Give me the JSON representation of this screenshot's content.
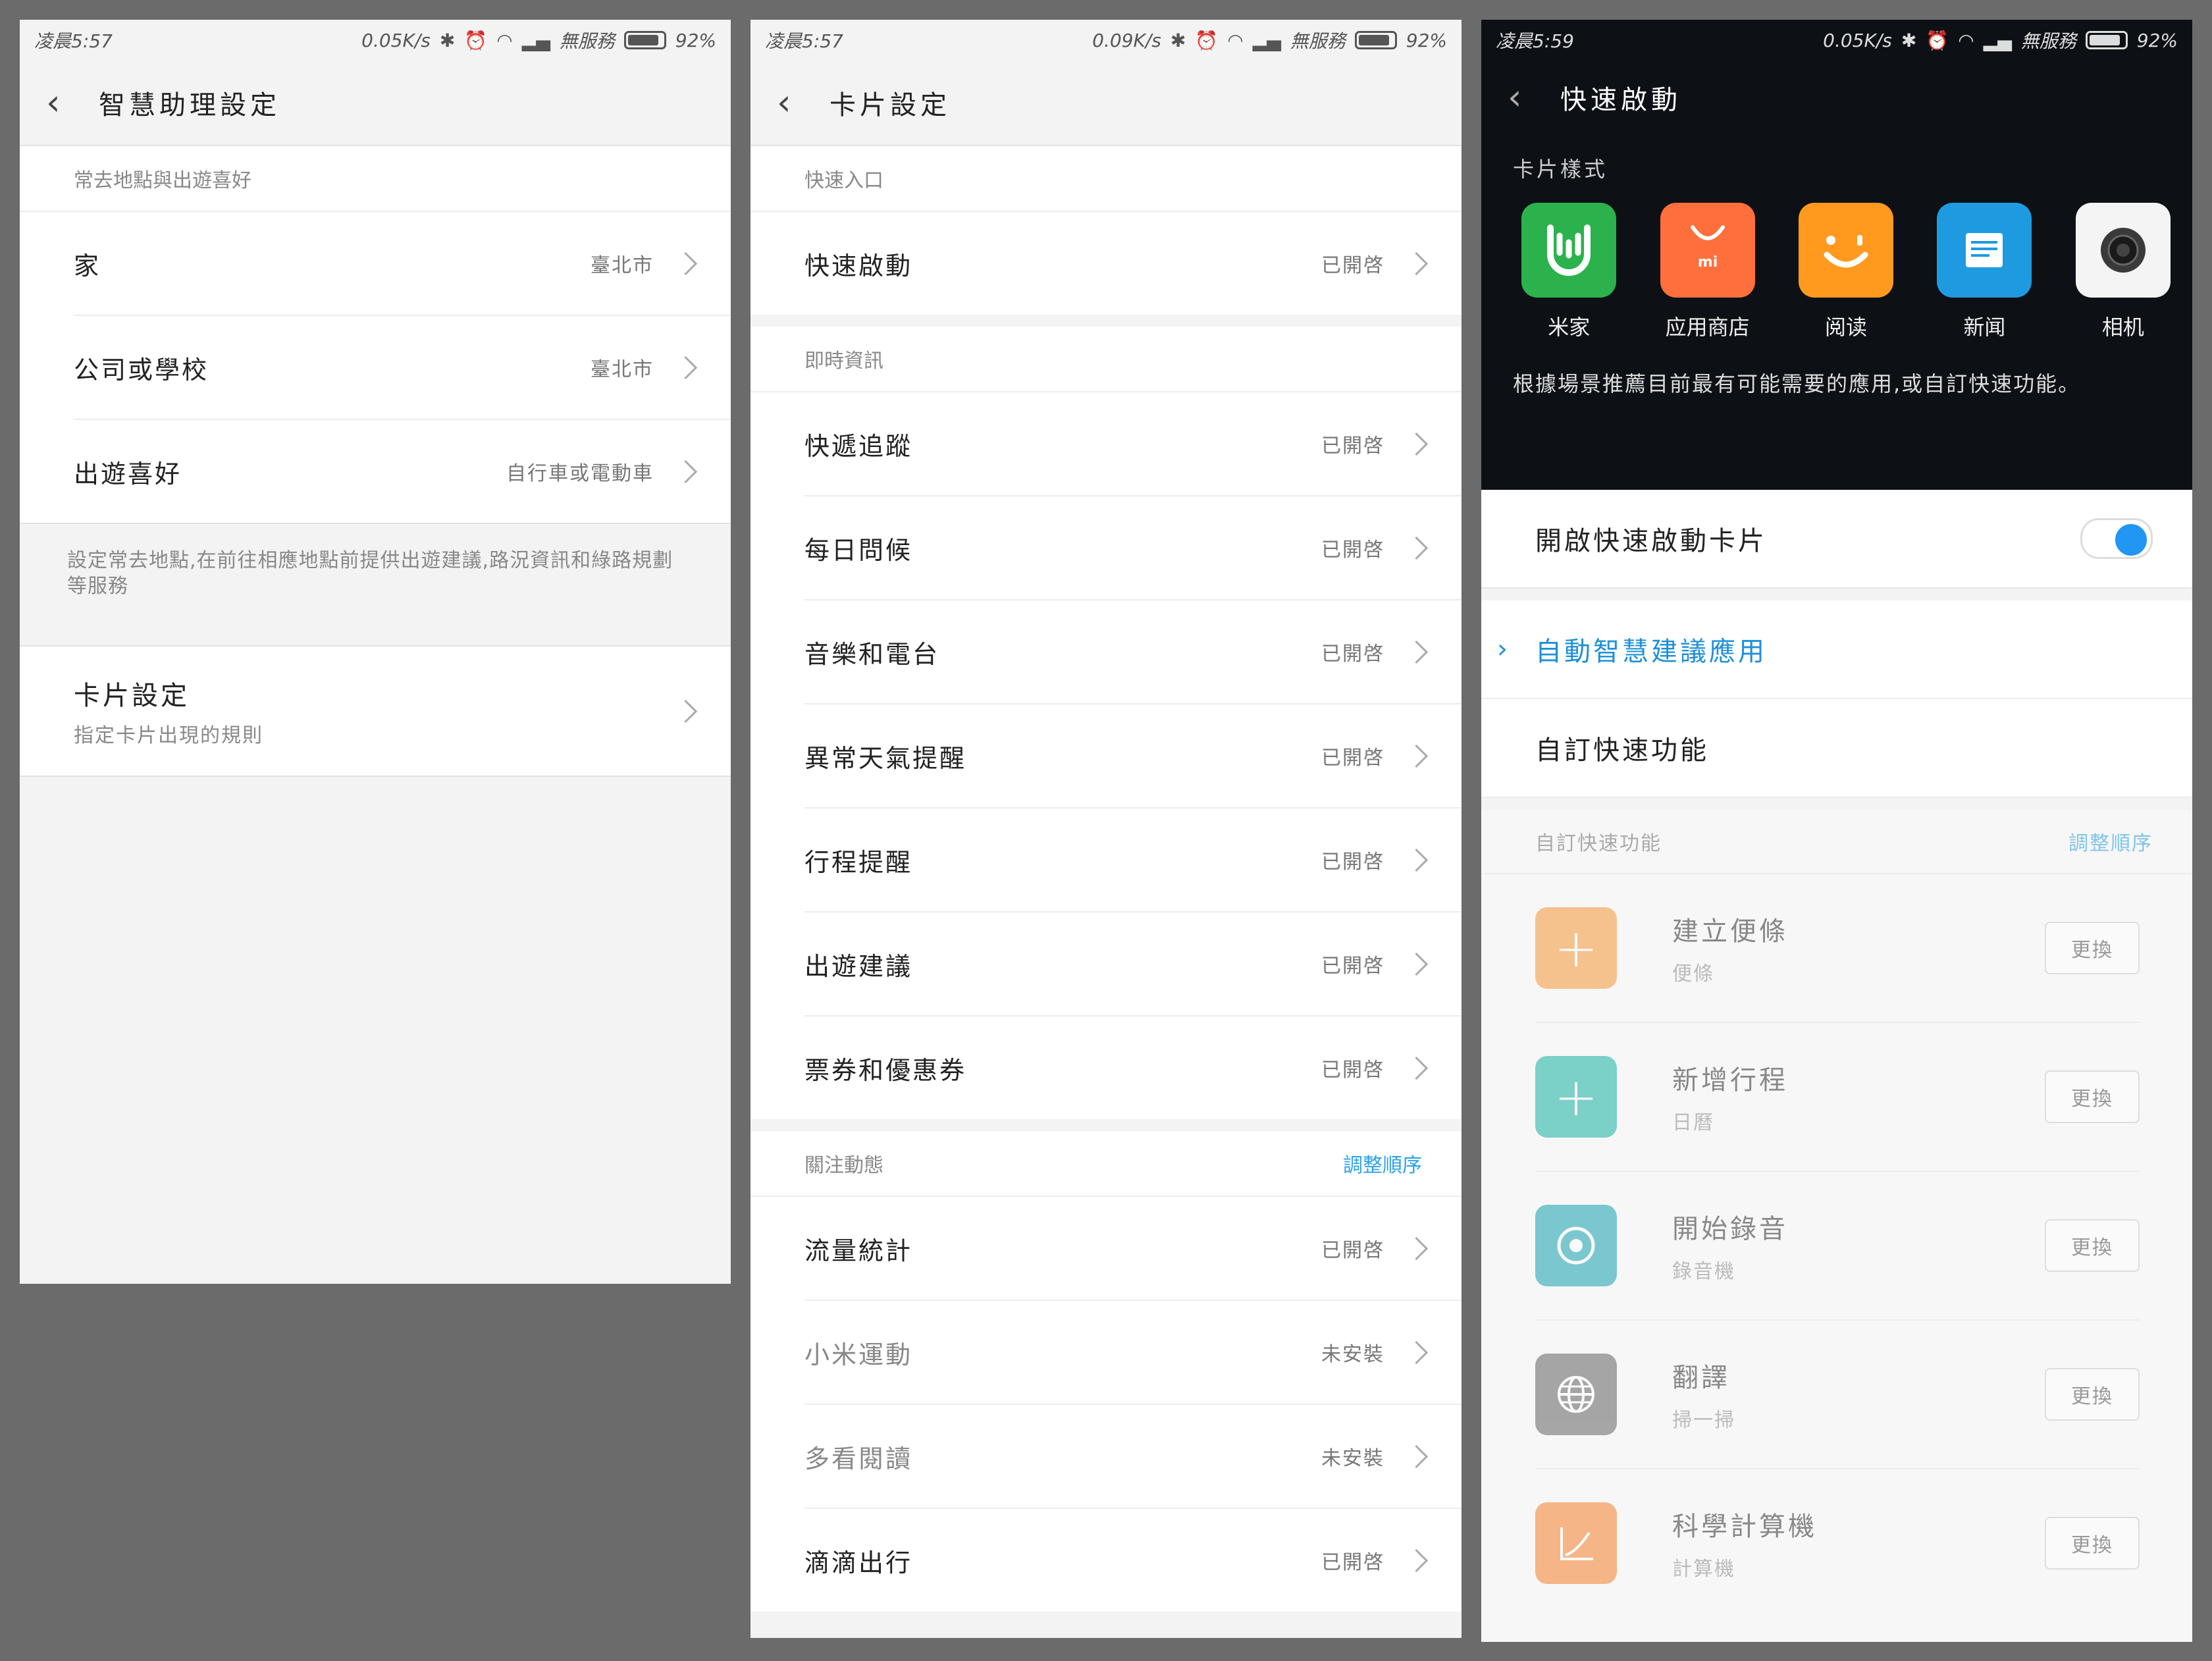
{
  "panel1": {
    "status": {
      "time": "凌晨5:57",
      "speed": "0.05K/s",
      "service": "無服務",
      "battery": "92%"
    },
    "title": "智慧助理設定",
    "section_header": "常去地點與出遊喜好",
    "rows": [
      {
        "label": "家",
        "value": "臺北市"
      },
      {
        "label": "公司或學校",
        "value": "臺北市"
      },
      {
        "label": "出遊喜好",
        "value": "自行車或電動車"
      }
    ],
    "note": "設定常去地點,在前往相應地點前提供出遊建議,路況資訊和綠路規劃等服務",
    "card_settings": {
      "title": "卡片設定",
      "subtitle": "指定卡片出現的規則"
    }
  },
  "panel2": {
    "status": {
      "time": "凌晨5:57",
      "speed": "0.09K/s",
      "service": "無服務",
      "battery": "92%"
    },
    "title": "卡片設定",
    "sections": [
      {
        "header": "快速入口",
        "rows": [
          {
            "label": "快速啟動",
            "value": "已開啓"
          }
        ]
      },
      {
        "header": "即時資訊",
        "rows": [
          {
            "label": "快遞追蹤",
            "value": "已開啓"
          },
          {
            "label": "每日問候",
            "value": "已開啓"
          },
          {
            "label": "音樂和電台",
            "value": "已開啓"
          },
          {
            "label": "異常天氣提醒",
            "value": "已開啓"
          },
          {
            "label": "行程提醒",
            "value": "已開啓"
          },
          {
            "label": "出遊建議",
            "value": "已開啓"
          },
          {
            "label": "票券和優惠券",
            "value": "已開啓"
          }
        ]
      },
      {
        "header": "關注動態",
        "header_link": "調整順序",
        "rows": [
          {
            "label": "流量統計",
            "value": "已開啓"
          },
          {
            "label": "小米運動",
            "value": "未安裝",
            "muted": true
          },
          {
            "label": "多看閱讀",
            "value": "未安裝",
            "muted": true
          },
          {
            "label": "滴滴出行",
            "value": "已開啓"
          }
        ]
      }
    ]
  },
  "panel3": {
    "status": {
      "time": "凌晨5:59",
      "speed": "0.05K/s",
      "service": "無服務",
      "battery": "92%"
    },
    "title": "快速啟動",
    "card_style_label": "卡片樣式",
    "apps": [
      {
        "label": "米家",
        "icon": "mijia-icon",
        "color": "#2bb24c"
      },
      {
        "label": "应用商店",
        "icon": "app-store-icon",
        "color": "#ff6f3c"
      },
      {
        "label": "阅读",
        "icon": "reader-icon",
        "color": "#ff9a1f"
      },
      {
        "label": "新闻",
        "icon": "news-icon",
        "color": "#1e9be0"
      },
      {
        "label": "相机",
        "icon": "camera-icon",
        "color": "#f4f4f4"
      }
    ],
    "description": "根據場景推薦目前最有可能需要的應用,或自訂快速功能。",
    "toggle_label": "開啟快速啟動卡片",
    "toggle_on": true,
    "options": [
      {
        "label": "自動智慧建議應用",
        "selected": true
      },
      {
        "label": "自訂快速功能",
        "selected": false
      }
    ],
    "custom_header": "自訂快速功能",
    "custom_link": "調整順序",
    "functions": [
      {
        "name": "建立便條",
        "sub": "便條",
        "button": "更換",
        "icon": "plus-icon",
        "color": "#f5a04a"
      },
      {
        "name": "新增行程",
        "sub": "日曆",
        "button": "更換",
        "icon": "plus-icon",
        "color": "#2ab7a9"
      },
      {
        "name": "開始錄音",
        "sub": "錄音機",
        "button": "更換",
        "icon": "record-icon",
        "color": "#2aa8b5"
      },
      {
        "name": "翻譯",
        "sub": "掃一掃",
        "button": "更換",
        "icon": "globe-icon",
        "color": "#6f6f6f"
      },
      {
        "name": "科學計算機",
        "sub": "計算機",
        "button": "更換",
        "icon": "calculator-icon",
        "color": "#f58a3c"
      }
    ]
  }
}
